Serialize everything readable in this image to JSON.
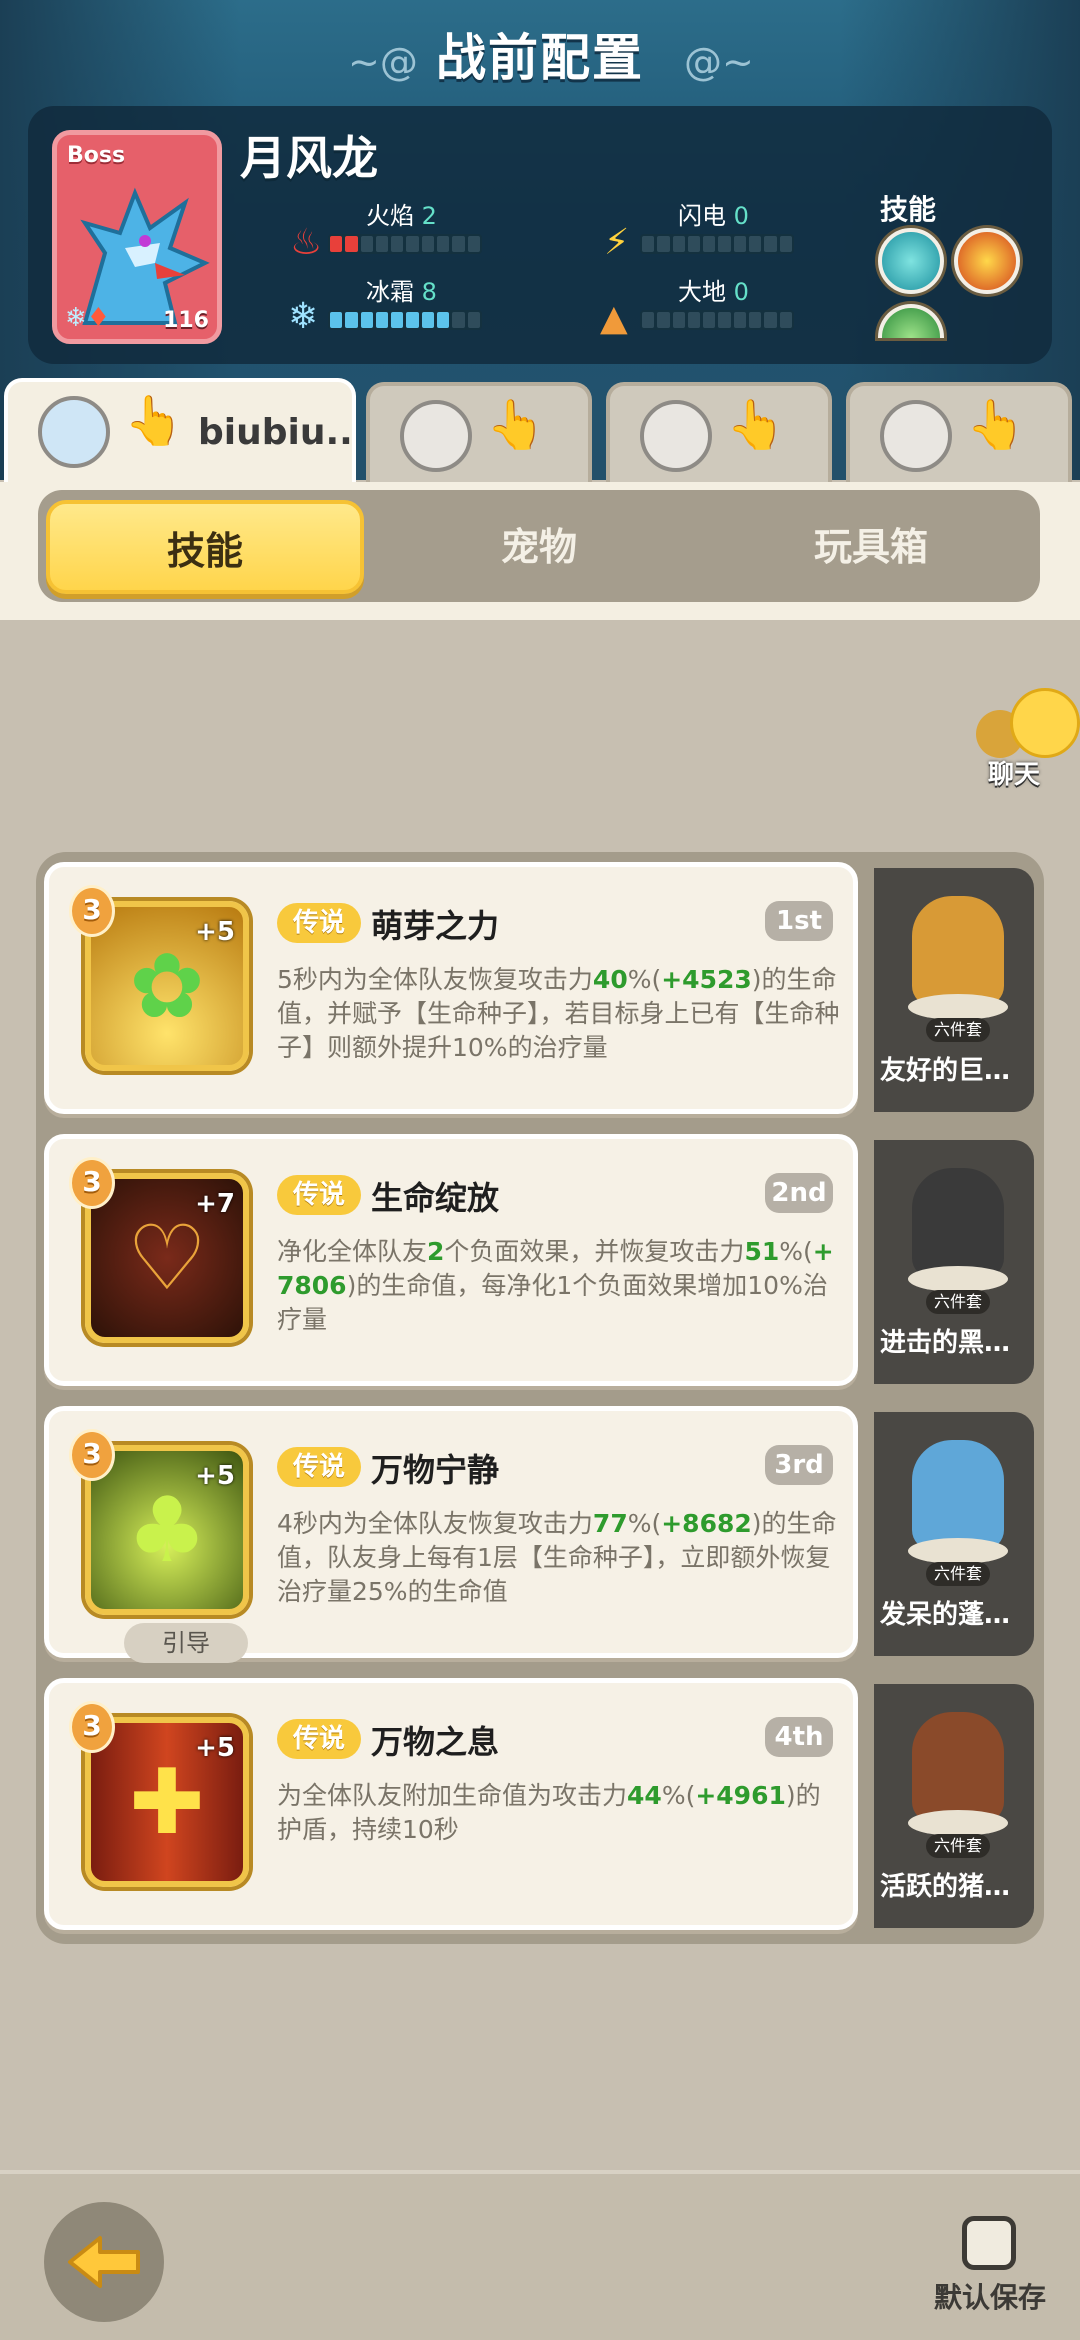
{
  "header": {
    "title": "战前配置",
    "boss": {
      "tag": "Boss",
      "name": "月风龙",
      "level": "116",
      "stats": [
        {
          "label": "火焰",
          "value": "2",
          "filled": 2,
          "color": "#e8403a"
        },
        {
          "label": "闪电",
          "value": "0",
          "filled": 0,
          "color": "#e8403a"
        },
        {
          "label": "冰霜",
          "value": "8",
          "filled": 8,
          "color": "#5cc3ea"
        },
        {
          "label": "大地",
          "value": "0",
          "filled": 0,
          "color": "#e8403a"
        }
      ],
      "skills_label": "技能"
    }
  },
  "players": [
    {
      "name": "biubiu..",
      "active": true
    },
    {
      "name": "",
      "active": false
    },
    {
      "name": "",
      "active": false
    },
    {
      "name": "",
      "active": false
    }
  ],
  "tabs": [
    {
      "label": "技能",
      "active": true
    },
    {
      "label": "宠物",
      "active": false
    },
    {
      "label": "玩具箱",
      "active": false
    }
  ],
  "chat": {
    "label": "聊天"
  },
  "skills": [
    {
      "level": "3",
      "plus": "+5",
      "rarity": "传说",
      "name": "萌芽之力",
      "rank": "1st",
      "desc": [
        {
          "t": "5秒内为全体队友恢复攻击力"
        },
        {
          "t": "40",
          "g": true
        },
        {
          "t": "%("
        },
        {
          "t": "+4523",
          "g": true
        },
        {
          "t": ")的生命值，并赋予【生命种子】，若目标身上已有【生命种子】则额外提升10%的治疗量"
        }
      ],
      "channel": "",
      "pet": {
        "set": "六件套",
        "name": "友好的巨…"
      }
    },
    {
      "level": "3",
      "plus": "+7",
      "rarity": "传说",
      "name": "生命绽放",
      "rank": "2nd",
      "desc": [
        {
          "t": "净化全体队友"
        },
        {
          "t": "2",
          "g": true
        },
        {
          "t": "个负面效果，并恢复攻击力"
        },
        {
          "t": "51",
          "g": true
        },
        {
          "t": "%("
        },
        {
          "t": "+7806",
          "g": true
        },
        {
          "t": ")的生命值，每净化1个负面效果增加10%治疗量"
        }
      ],
      "channel": "",
      "pet": {
        "set": "六件套",
        "name": "进击的黑…"
      }
    },
    {
      "level": "3",
      "plus": "+5",
      "rarity": "传说",
      "name": "万物宁静",
      "rank": "3rd",
      "desc": [
        {
          "t": "4秒内为全体队友恢复攻击力"
        },
        {
          "t": "77",
          "g": true
        },
        {
          "t": "%("
        },
        {
          "t": "+8682",
          "g": true
        },
        {
          "t": ")的生命值，队友身上每有1层【生命种子】，立即额外恢复治疗量25%的生命值"
        }
      ],
      "channel": "引导",
      "pet": {
        "set": "六件套",
        "name": "发呆的蓬…"
      }
    },
    {
      "level": "3",
      "plus": "+5",
      "rarity": "传说",
      "name": "万物之息",
      "rank": "4th",
      "desc": [
        {
          "t": "为全体队友附加生命值为攻击力"
        },
        {
          "t": "44",
          "g": true
        },
        {
          "t": "%("
        },
        {
          "t": "+4961",
          "g": true
        },
        {
          "t": ")的护盾，持续10秒"
        }
      ],
      "channel": "",
      "pet": {
        "set": "六件套",
        "name": "活跃的猪…"
      }
    }
  ],
  "footer": {
    "save_label": "默认保存"
  },
  "colors": {
    "accent_yellow": "#ffd54b",
    "highlight_green": "#2e9b2d",
    "rarity_gold": "#f8c93c"
  }
}
